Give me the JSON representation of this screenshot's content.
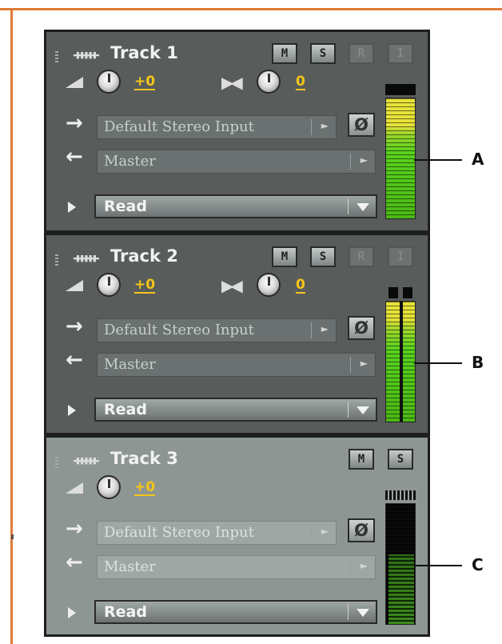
{
  "tracks": [
    {
      "name": "Track 1",
      "mute": "M",
      "solo": "S",
      "arm": "R",
      "monitor": "I",
      "volume": "+0",
      "pan": "0",
      "input": "Default Stereo Input",
      "output": "Master",
      "automation": "Read",
      "meter_level": 0.9,
      "meter_label": "A"
    },
    {
      "name": "Track 2",
      "mute": "M",
      "solo": "S",
      "arm": "R",
      "monitor": "I",
      "volume": "+0",
      "pan": "0",
      "input": "Default Stereo Input",
      "output": "Master",
      "automation": "Read",
      "meter_level": 0.9,
      "meter_label": "B"
    },
    {
      "name": "Track 3",
      "mute": "M",
      "solo": "S",
      "volume": "+0",
      "input": "Default Stereo Input",
      "output": "Master",
      "automation": "Read",
      "meter_level": 0.5,
      "meter_label": "C"
    }
  ],
  "icons": {
    "phase": "Ø",
    "input_arrow": "→",
    "output_arrow": "←",
    "track_type": "ᚔ",
    "pan": "▶◀"
  },
  "colors": {
    "frame": "#e07b39",
    "value": "#f5c518",
    "meter_green": "#58d21e",
    "meter_yellow": "#e8e23a"
  }
}
